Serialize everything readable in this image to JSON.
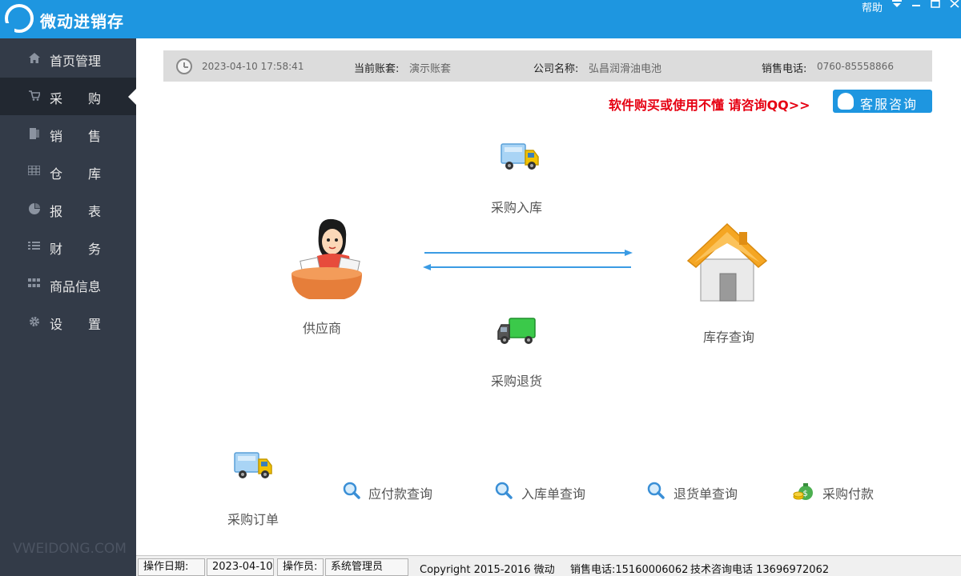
{
  "app": {
    "title": "微动进销存"
  },
  "window": {
    "help": "帮助"
  },
  "sidebar": {
    "items": [
      {
        "label": "首页管理",
        "icon": "home-icon",
        "active": false
      },
      {
        "label": "采　　购",
        "icon": "cart-icon",
        "active": true
      },
      {
        "label": "销　　售",
        "icon": "sales-icon",
        "active": false
      },
      {
        "label": "仓　　库",
        "icon": "warehouse-icon",
        "active": false
      },
      {
        "label": "报　　表",
        "icon": "pie-chart-icon",
        "active": false
      },
      {
        "label": "财　　务",
        "icon": "finance-icon",
        "active": false
      },
      {
        "label": "商品信息",
        "icon": "grid-icon",
        "active": false
      },
      {
        "label": "设　　置",
        "icon": "gear-icon",
        "active": false
      }
    ],
    "watermark": "VWEIDONG.COM"
  },
  "infobar": {
    "datetime": "2023-04-10 17:58:41",
    "account_label": "当前账套:",
    "account_value": "演示账套",
    "company_label": "公司名称:",
    "company_value": "弘昌润滑油电池",
    "phone_label": "销售电话:",
    "phone_value": "0760-85558866"
  },
  "consult": {
    "text": "软件购买或使用不懂 请咨询QQ>>",
    "button": "客服咨询"
  },
  "flow": {
    "purchase_in": "采购入库",
    "supplier": "供应商",
    "inventory": "库存查询",
    "purchase_return": "采购退货"
  },
  "bottom": {
    "purchase_order": "采购订单",
    "payable_query": "应付款查询",
    "receipt_query": "入库单查询",
    "return_query": "退货单查询",
    "purchase_payment": "采购付款"
  },
  "statusbar": {
    "date_label": "操作日期:",
    "date_value": "2023-04-10",
    "operator_label": "操作员:",
    "operator_value": "系统管理员",
    "copyright": "Copyright  2015-2016 微动",
    "sales_phone": "销售电话:15160006062",
    "tech_phone": "技术咨询电话 13696972062"
  },
  "colors": {
    "brand": "#1e96e0",
    "sidebar": "#333b48",
    "sidebar_active": "#222831",
    "consult_text": "#e60012"
  }
}
